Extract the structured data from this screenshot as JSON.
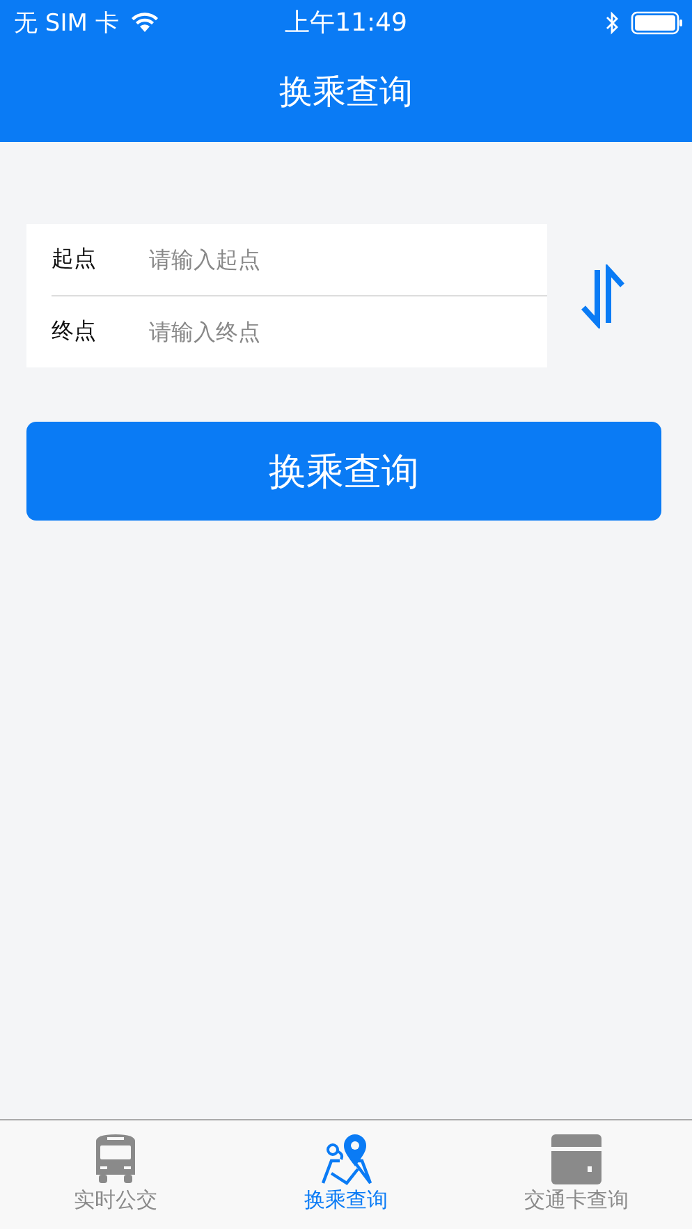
{
  "status_bar": {
    "carrier": "无 SIM 卡",
    "time": "上午11:49"
  },
  "nav": {
    "title": "换乘查询"
  },
  "form": {
    "fields": [
      {
        "label": "起点",
        "placeholder": "请输入起点"
      },
      {
        "label": "终点",
        "placeholder": "请输入终点"
      }
    ]
  },
  "search_button": "换乘查询",
  "tabs": [
    {
      "kind": "bus",
      "label": "实时公交",
      "selected": false
    },
    {
      "kind": "map",
      "label": "换乘查询",
      "selected": true
    },
    {
      "kind": "card",
      "label": "交通卡查询",
      "selected": false
    }
  ]
}
